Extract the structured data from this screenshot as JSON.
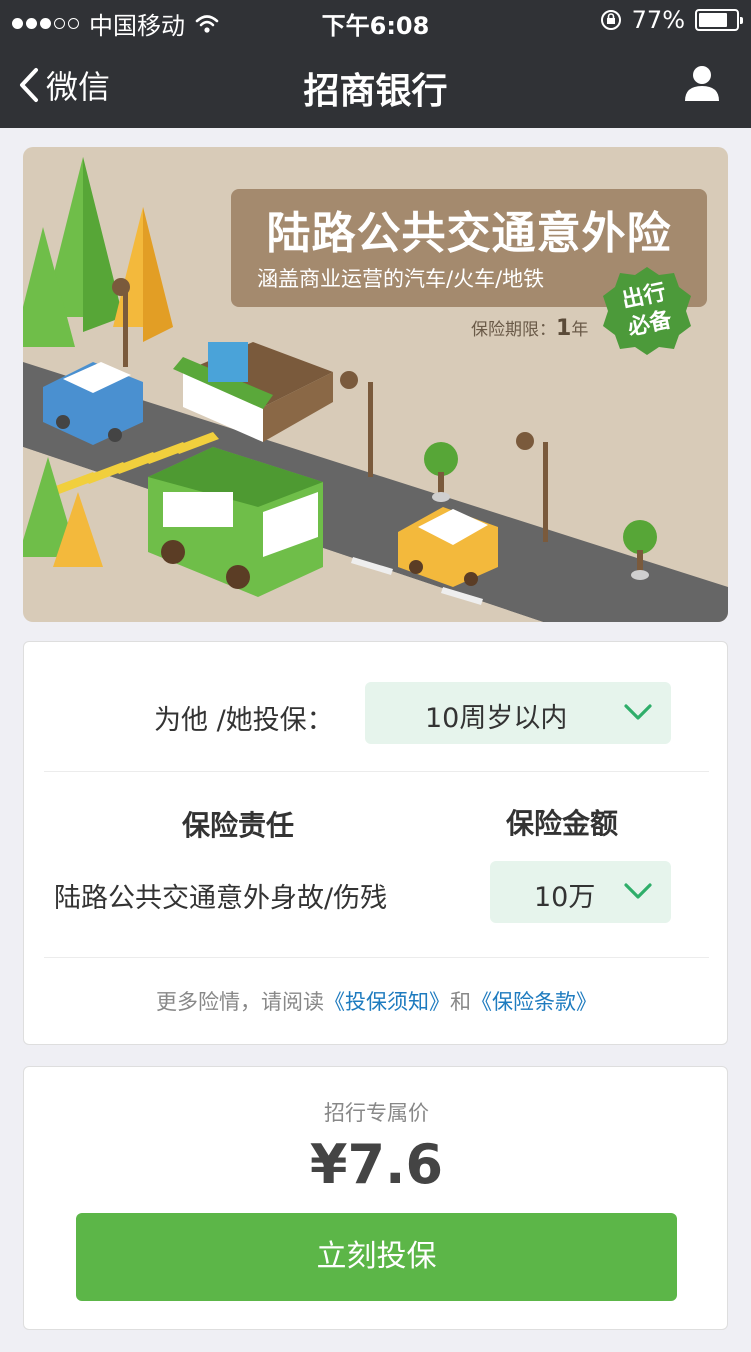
{
  "status_bar": {
    "carrier": "中国移动",
    "time": "下午6:08",
    "battery": "77%",
    "battery_level": 0.77
  },
  "nav": {
    "back_label": "微信",
    "title": "招商银行"
  },
  "banner": {
    "title": "陆路公共交通意外险",
    "subtitle": "涵盖商业运营的汽车/火车/地铁",
    "period_label": "保险期限：",
    "period_value": "1",
    "period_unit": "年",
    "badge_line1": "出行",
    "badge_line2": "必备"
  },
  "form": {
    "insure_label": "为他 /她投保：",
    "age_value": "10周岁以内",
    "col_duty": "保险责任",
    "col_amount": "保险金额",
    "duty_item": "陆路公共交通意外身故/伤残",
    "amount_value": "10万",
    "notice_prefix": "更多险情，请阅读",
    "notice_link1": "《投保须知》",
    "notice_and": "和",
    "notice_link2": "《保险条款》"
  },
  "price": {
    "label": "招行专属价",
    "value": "¥7.6",
    "button": "立刻投保"
  },
  "colors": {
    "header_bg": "#303236",
    "accent_green": "#5cb648",
    "select_bg": "#e6f4ec",
    "link_blue": "#1e7bbf"
  }
}
